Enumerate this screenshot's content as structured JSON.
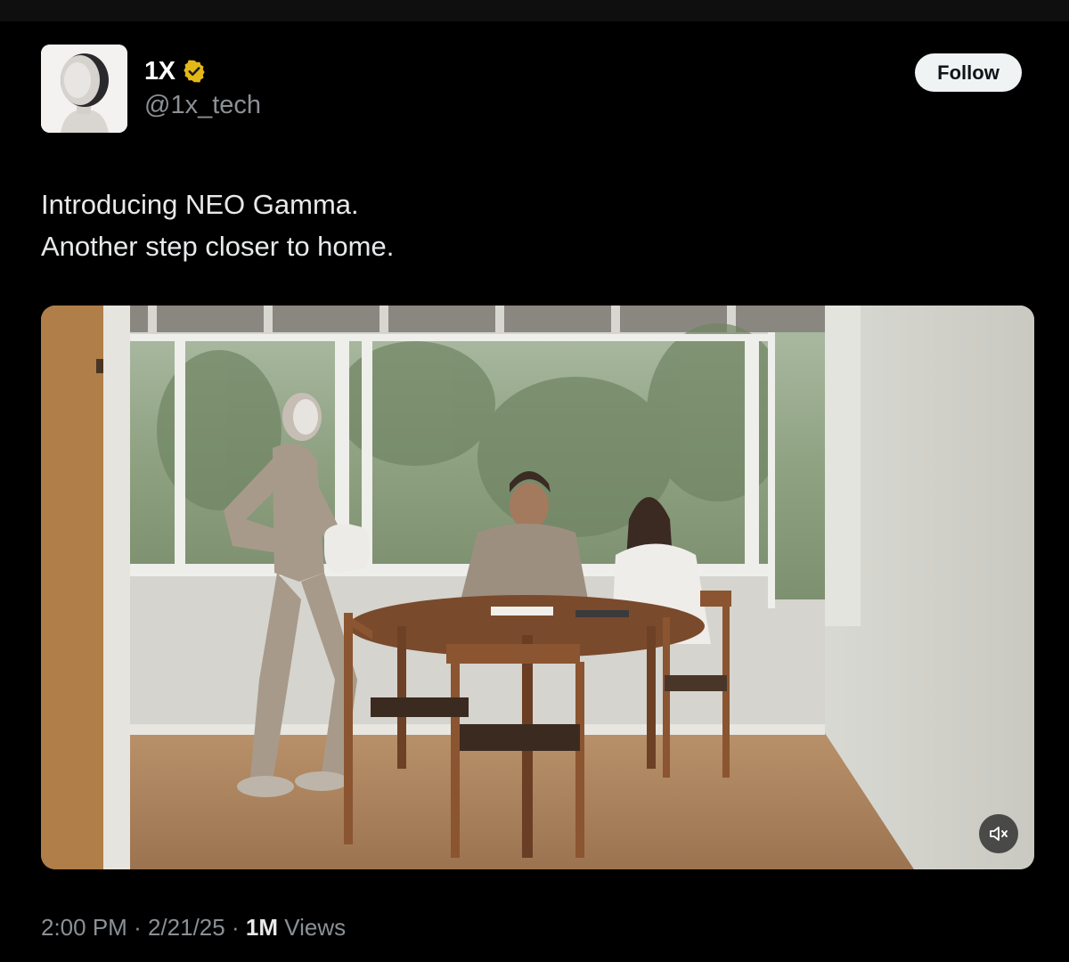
{
  "author": {
    "display_name": "1X",
    "handle": "@1x_tech",
    "avatar_icon": "humanoid-robot-head-avatar",
    "verified_badge_color": "#e2b719"
  },
  "follow_button": {
    "label": "Follow"
  },
  "post": {
    "text_lines": [
      "Introducing NEO Gamma.",
      "Another step closer to home."
    ]
  },
  "media": {
    "type": "video",
    "description_icon": "video-frame",
    "mute_icon": "speaker-muted-icon"
  },
  "meta": {
    "time": "2:00 PM",
    "date": "2/21/25",
    "views_count": "1M",
    "views_label": "Views",
    "separator": "·"
  }
}
